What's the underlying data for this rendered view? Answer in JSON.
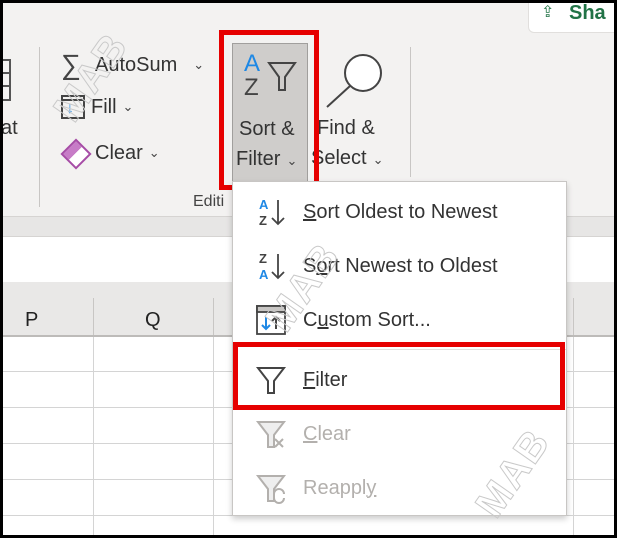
{
  "ribbon": {
    "share_label": "Sha",
    "format_label_partial": "at",
    "autosum_label": "AutoSum",
    "fill_label": "Fill",
    "clear_label": "Clear",
    "sort_filter_line1": "Sort &",
    "sort_filter_line2": "Filter",
    "find_select_line1": "Find &",
    "find_select_line2": "Select",
    "group_label_partial": "Editi",
    "chevron": "⌄"
  },
  "sheet": {
    "columns": [
      "P",
      "Q"
    ]
  },
  "menu": {
    "items": [
      {
        "pre": "",
        "accel": "S",
        "post": "ort Oldest to Newest",
        "icon": "sort-ascending-icon",
        "enabled": true
      },
      {
        "pre": "S",
        "accel": "o",
        "post": "rt Newest to Oldest",
        "icon": "sort-descending-icon",
        "enabled": true
      },
      {
        "pre": "C",
        "accel": "u",
        "post": "stom Sort...",
        "icon": "custom-sort-icon",
        "enabled": true
      },
      {
        "pre": "",
        "accel": "F",
        "post": "ilter",
        "icon": "filter-icon",
        "enabled": true,
        "highlighted": true
      },
      {
        "pre": "",
        "accel": "C",
        "post": "lear",
        "icon": "clear-filter-icon",
        "enabled": false
      },
      {
        "pre": "Reappl",
        "accel": "y",
        "post": "",
        "icon": "reapply-filter-icon",
        "enabled": false
      }
    ]
  },
  "watermark": "MAB",
  "colors": {
    "highlight_box": "#e60000",
    "accent_blue": "#1e88e5",
    "share_green": "#217346",
    "disabled_text": "#b3b0ad"
  }
}
